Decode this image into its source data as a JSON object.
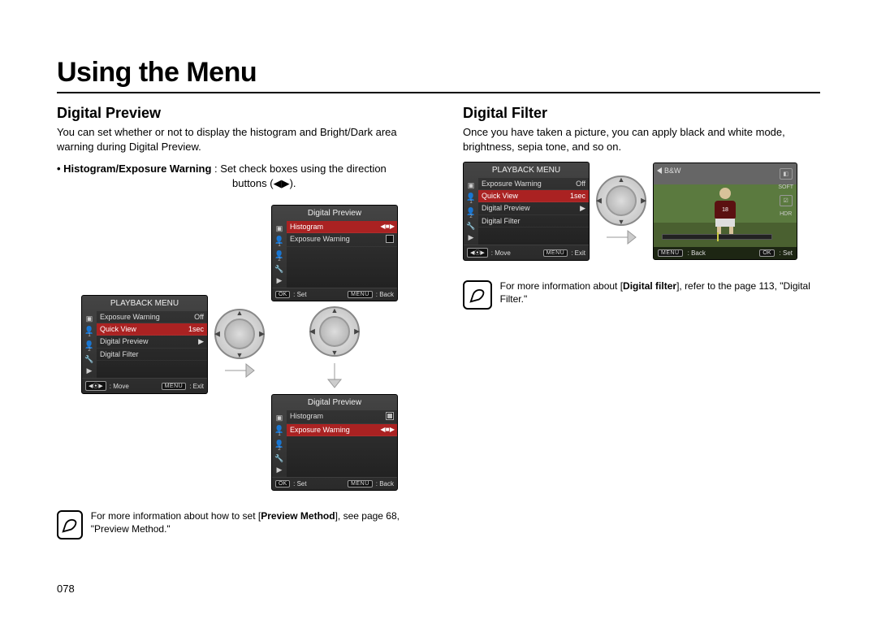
{
  "page_title": "Using the Menu",
  "page_number": "078",
  "left": {
    "section_title": "Digital Preview",
    "intro": "You can set whether or not to display the histogram and Bright/Dark area warning during Digital Preview.",
    "bullet_label": "• Histogram/Exposure Warning",
    "bullet_sep": " : ",
    "bullet_rest": "Set check boxes using the direction",
    "bullet_rest2": "buttons (◀▶).",
    "lcd1": {
      "title": "PLAYBACK MENU",
      "rows": [
        {
          "label": "Exposure Warning",
          "value": "Off"
        },
        {
          "label": "Quick View",
          "value": "1sec",
          "hl": true
        },
        {
          "label": "Digital Preview",
          "value": "▶"
        },
        {
          "label": "Digital Filter",
          "value": ""
        }
      ],
      "footer_left_chip": "◀⦿▶",
      "footer_left": ": Move",
      "footer_right_chip": "MENU",
      "footer_right": ": Exit"
    },
    "lcd2": {
      "title": "Digital Preview",
      "rows": [
        {
          "label": "Histogram",
          "value": "◀ ■ ▶",
          "hl": true
        },
        {
          "label": "Exposure Warning",
          "value": "■"
        }
      ],
      "footer_left_chip": "OK",
      "footer_left": ": Set",
      "footer_right_chip": "MENU",
      "footer_right": ": Back"
    },
    "lcd3": {
      "title": "Digital Preview",
      "rows": [
        {
          "label": "Histogram",
          "value": "■"
        },
        {
          "label": "Exposure Warning",
          "value": "◀ ■ ▶",
          "hl": true
        }
      ],
      "footer_left_chip": "OK",
      "footer_left": ": Set",
      "footer_right_chip": "MENU",
      "footer_right": ": Back"
    },
    "note_pre": "For more information about how to set [",
    "note_bold": "Preview Method",
    "note_post": "], see page 68, \"Preview Method.\""
  },
  "right": {
    "section_title": "Digital Filter",
    "intro": "Once you have taken a picture, you can apply black and white mode, brightness, sepia tone, and so on.",
    "lcd1": {
      "title": "PLAYBACK MENU",
      "rows": [
        {
          "label": "Exposure Warning",
          "value": "Off"
        },
        {
          "label": "Quick View",
          "value": "1sec",
          "hl": true
        },
        {
          "label": "Digital Preview",
          "value": "▶"
        },
        {
          "label": "Digital Filter",
          "value": ""
        }
      ],
      "footer_left_chip": "◀⦿▶",
      "footer_left": ": Move",
      "footer_right_chip": "MENU",
      "footer_right": ": Exit"
    },
    "preview": {
      "top_left": "B&W",
      "jersey": "18",
      "right_labels": [
        "◧",
        "SOFT",
        "☑",
        "HDR"
      ],
      "footer_left_chip": "MENU",
      "footer_left": ": Back",
      "footer_right_chip": "OK",
      "footer_right": ": Set"
    },
    "note_pre": "For more information about [",
    "note_bold": "Digital filter",
    "note_post": "], refer to the page 113, \"Digital Filter.\""
  },
  "side_icons": {
    "camera": "▣",
    "person": "👤"
  }
}
